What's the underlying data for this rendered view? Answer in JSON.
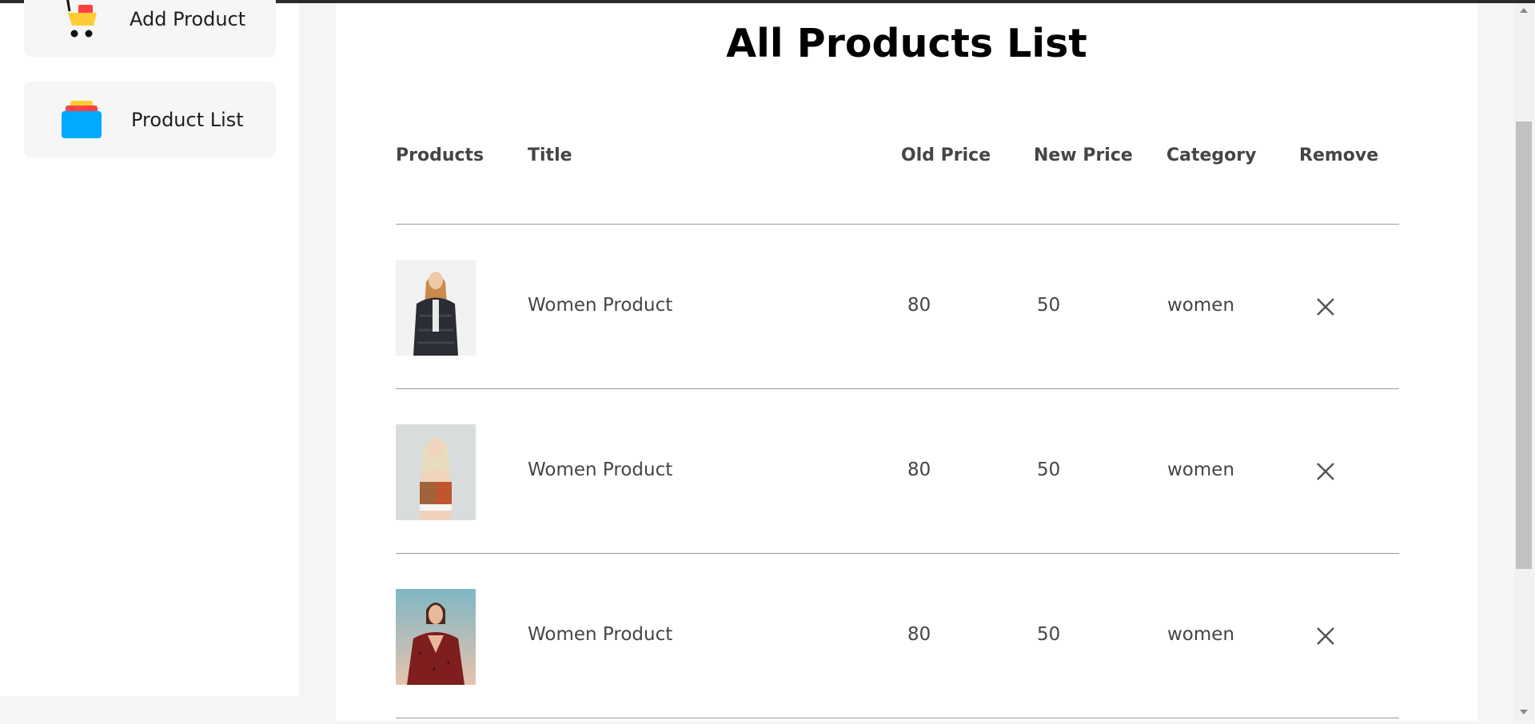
{
  "sidebar": {
    "items": [
      {
        "label": "Add Product",
        "icon": "add-product-cart-icon"
      },
      {
        "label": "Product List",
        "icon": "product-list-stack-icon"
      }
    ]
  },
  "main": {
    "title": "All Products List",
    "columns": [
      "Products",
      "Title",
      "Old Price",
      "New Price",
      "Category",
      "Remove"
    ],
    "rows": [
      {
        "image": "women-jacket-photo",
        "title": "Women Product",
        "old_price": "80",
        "new_price": "50",
        "category": "women",
        "remove_icon": "remove-x-icon"
      },
      {
        "image": "women-croptop-photo",
        "title": "Women Product",
        "old_price": "80",
        "new_price": "50",
        "category": "women",
        "remove_icon": "remove-x-icon"
      },
      {
        "image": "women-red-blouse-photo",
        "title": "Women Product",
        "old_price": "80",
        "new_price": "50",
        "category": "women",
        "remove_icon": "remove-x-icon"
      }
    ]
  },
  "colors": {
    "page_background": "#f5f5f5",
    "panel_background": "#ffffff",
    "sidebar_item_background": "#f6f6f6",
    "text": "#454545",
    "title_text": "#000000",
    "rule": "#999999",
    "list_icon_front": "#00aaff",
    "list_icon_middle": "#ff4141",
    "list_icon_back": "#ffcc33"
  }
}
